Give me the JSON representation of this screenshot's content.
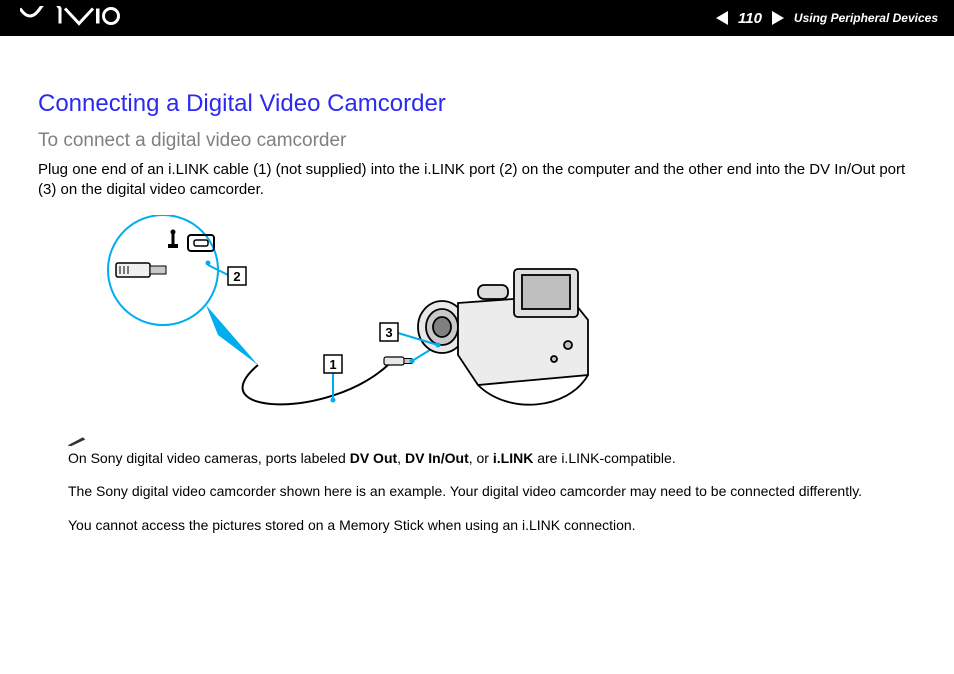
{
  "header": {
    "page_number": "110",
    "section": "Using Peripheral Devices"
  },
  "title": "Connecting a Digital Video Camcorder",
  "subtitle": "To connect a digital video camcorder",
  "intro": "Plug one end of an i.LINK cable (1) (not supplied) into the i.LINK port (2) on the computer and the other end into the DV In/Out port (3) on the digital video camcorder.",
  "diagram": {
    "callout_1": "1",
    "callout_2": "2",
    "callout_3": "3"
  },
  "notes": {
    "n1_pre": "On Sony digital video cameras, ports labeled ",
    "n1_b1": "DV Out",
    "n1_s1": ", ",
    "n1_b2": "DV In/Out",
    "n1_s2": ", or ",
    "n1_b3": "i.LINK",
    "n1_post": " are i.LINK-compatible.",
    "n2": "The Sony digital video camcorder shown here is an example. Your digital video camcorder may need to be connected differently.",
    "n3": "You cannot access the pictures stored on a Memory Stick when using an i.LINK connection."
  }
}
